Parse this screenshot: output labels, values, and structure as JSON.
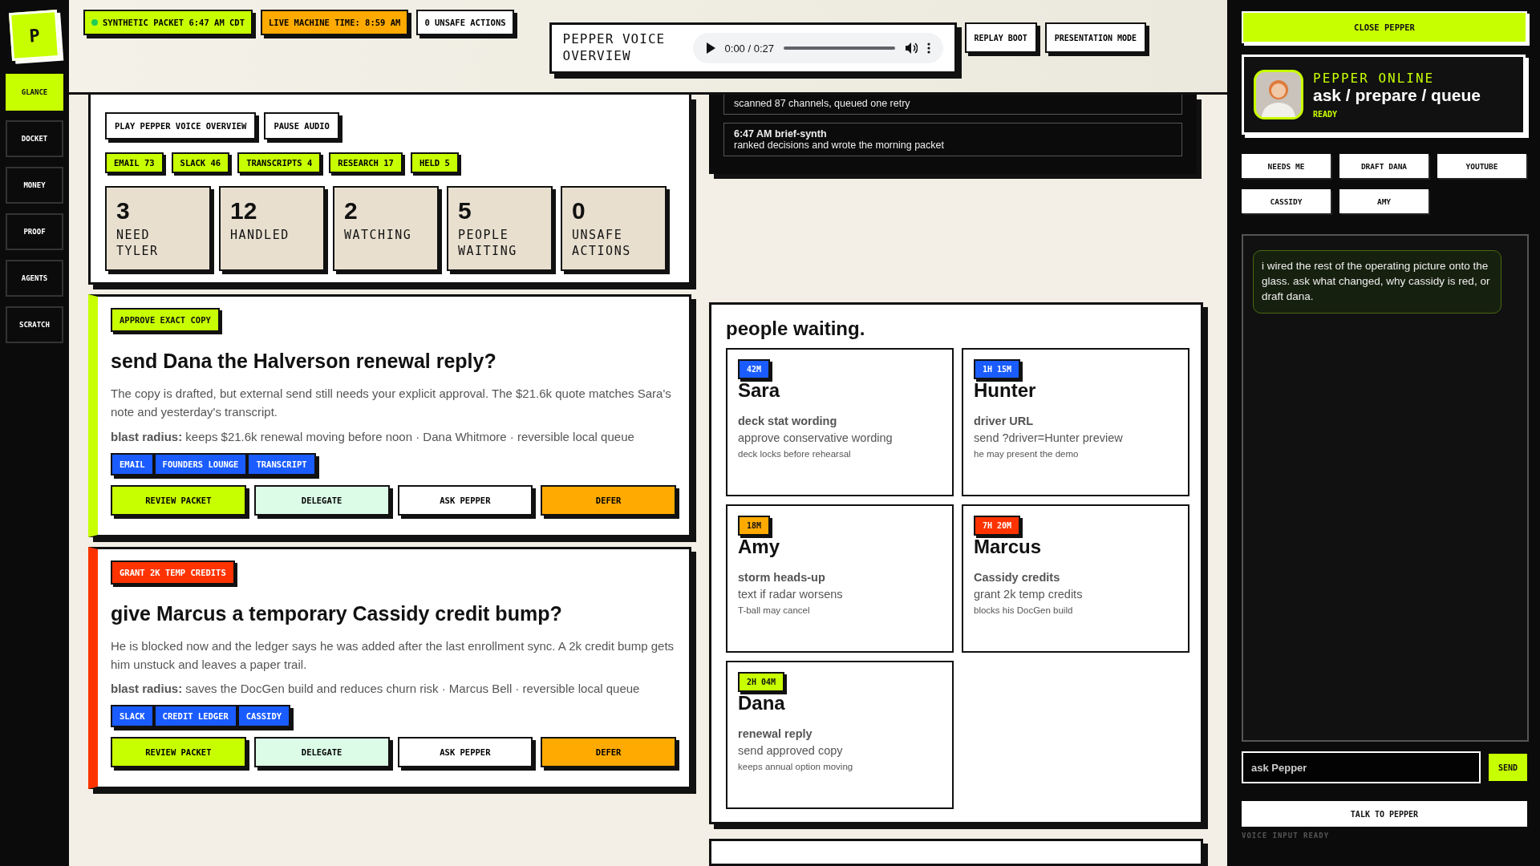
{
  "nav": {
    "logo": "P",
    "items": [
      {
        "label": "GLANCE",
        "selected": true
      },
      {
        "label": "DOCKET",
        "selected": false
      },
      {
        "label": "MONEY",
        "selected": false
      },
      {
        "label": "PROOF",
        "selected": false
      },
      {
        "label": "AGENTS",
        "selected": false
      },
      {
        "label": "SCRATCH",
        "selected": false
      }
    ]
  },
  "header": {
    "badges": [
      {
        "text": "SYNTHETIC PACKET 6:47 AM CDT",
        "kind": "live"
      },
      {
        "text": "LIVE MACHINE TIME: 8:59 AM",
        "kind": "warn"
      },
      {
        "text": "0 UNSAFE ACTIONS",
        "kind": "plain"
      }
    ],
    "voice": {
      "title": "PEPPER VOICE OVERVIEW",
      "time": "0:00 / 0:27"
    },
    "buttons": [
      "REPLAY BOOT",
      "PRESENTATION MODE"
    ]
  },
  "overview": {
    "buttons": [
      "PLAY PEPPER VOICE OVERVIEW",
      "PAUSE AUDIO"
    ],
    "sources": [
      "EMAIL 73",
      "SLACK 46",
      "TRANSCRIPTS 4",
      "RESEARCH 17",
      "HELD 5"
    ],
    "stats": [
      {
        "value": "3",
        "label": "NEED TYLER"
      },
      {
        "value": "12",
        "label": "HANDLED"
      },
      {
        "value": "2",
        "label": "WATCHING"
      },
      {
        "value": "5",
        "label": "PEOPLE WAITING"
      },
      {
        "value": "0",
        "label": "UNSAFE ACTIONS"
      }
    ]
  },
  "decisions": [
    {
      "tag": "APPROVE EXACT COPY",
      "color": "#c8ff00",
      "title": "send Dana the Halverson renewal reply?",
      "body": "The copy is drafted, but external send still needs your explicit approval. The $21.6k quote matches Sara's note and yesterday's transcript.",
      "blast": "**blast radius:** keeps $21.6k renewal moving before noon · Dana Whitmore · reversible local queue",
      "sources": [
        "EMAIL",
        "FOUNDERS LOUNGE",
        "TRANSCRIPT"
      ],
      "actions": [
        {
          "label": "REVIEW PACKET",
          "kind": "primary"
        },
        {
          "label": "DELEGATE",
          "kind": "delegate"
        },
        {
          "label": "ASK PEPPER",
          "kind": "ask"
        },
        {
          "label": "DEFER",
          "kind": "defer"
        }
      ]
    },
    {
      "tag": "GRANT 2K TEMP CREDITS",
      "color": "#ff3300",
      "title": "give Marcus a temporary Cassidy credit bump?",
      "body": "He is blocked now and the ledger says he was added after the last enrollment sync. A 2k credit bump gets him unstuck and leaves a paper trail.",
      "blast": "**blast radius:** saves the DocGen build and reduces churn risk · Marcus Bell · reversible local queue",
      "sources": [
        "SLACK",
        "CREDIT LEDGER",
        "CASSIDY"
      ],
      "actions": [
        {
          "label": "REVIEW PACKET",
          "kind": "primary"
        },
        {
          "label": "DELEGATE",
          "kind": "delegate"
        },
        {
          "label": "ASK PEPPER",
          "kind": "ask"
        },
        {
          "label": "DEFER",
          "kind": "defer"
        }
      ]
    }
  ],
  "activity": [
    {
      "text": "scanned 87 channels, queued one retry"
    },
    {
      "title": "6:47 AM brief-synth",
      "text": "ranked decisions and wrote the morning packet"
    }
  ],
  "people": {
    "title": "people waiting.",
    "items": [
      {
        "wait": "42M",
        "color": "#1a5cff",
        "name": "Sara",
        "topic": "deck stat wording",
        "action": "approve conservative wording",
        "note": "deck locks before rehearsal"
      },
      {
        "wait": "1H 15M",
        "color": "#1a5cff",
        "name": "Hunter",
        "topic": "driver URL",
        "action": "send ?driver=Hunter preview",
        "note": "he may present the demo"
      },
      {
        "wait": "18M",
        "color": "#ffaa00",
        "name": "Amy",
        "topic": "storm heads-up",
        "action": "text if radar worsens",
        "note": "T-ball may cancel"
      },
      {
        "wait": "7H 20M",
        "color": "#ff3300",
        "name": "Marcus",
        "topic": "Cassidy credits",
        "action": "grant 2k temp credits",
        "note": "blocks his DocGen build"
      },
      {
        "wait": "2H 04M",
        "color": "#c8ff00",
        "name": "Dana",
        "topic": "renewal reply",
        "action": "send approved copy",
        "note": "keeps annual option moving"
      }
    ]
  },
  "pepper": {
    "close": "CLOSE PEPPER",
    "status": "PEPPER ONLINE",
    "headline": "ask / prepare / queue",
    "state": "READY",
    "chips": [
      "NEEDS ME",
      "DRAFT DANA",
      "YOUTUBE",
      "CASSIDY",
      "AMY"
    ],
    "messages": [
      "i wired the rest of the operating picture onto the glass. ask what changed, why cassidy is red, or draft dana."
    ],
    "input": {
      "placeholder": "ask Pepper"
    },
    "send": "SEND",
    "talk": "TALK TO PEPPER",
    "voice_status": "VOICE INPUT READY"
  }
}
